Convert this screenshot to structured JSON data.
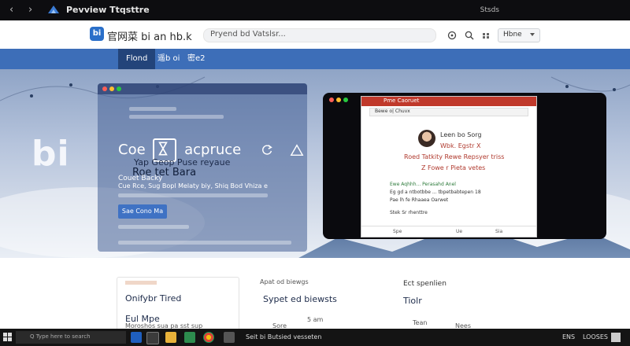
{
  "window": {
    "back": "‹",
    "forward": "›",
    "title": "Pevview Ttqsttre",
    "right_text": "Stsds"
  },
  "header": {
    "brand_badge": "bi",
    "brand_text": "官网菜 bi an hb.k",
    "search_placeholder": "Pryend bd Vatslsr...",
    "locale_label": "Hbne"
  },
  "nav": {
    "items": [
      {
        "label": "Flond",
        "active": true
      },
      {
        "label": "遥b oi",
        "active": false
      },
      {
        "label": "密e2",
        "active": false
      }
    ]
  },
  "hero": {
    "logo": "bi",
    "left_window": {
      "title": "Coe",
      "title_suffix": "acpruce",
      "subtitle1": "Yap Geop Puse reyaue",
      "subtitle2": "Roe tet Bara",
      "label": "Couet Backy",
      "line": "Cue Rce, Sug Bopl Melaty biy, Shiq Bod Vhiza e",
      "button": "Sae Cono Ma"
    },
    "inner_window": {
      "tab": "Pme Caoruet",
      "url": "Bewe o| Chuvx",
      "name": "Leen bo Sorg",
      "line1": "Wbk. Egstr X",
      "line2": "Roed Tatkity Rewe Repsyer triss",
      "line3": "Z Fowe r Pieta vetes",
      "small1": "Ewe Aqhhh... Perasahd Anel",
      "small2": "Eg gd a ntbotbbe ... tbpetbabtepen 18",
      "small3": "Pae lh fe Rhaaea Oarwet",
      "small4": "Stek Sr rhenttre",
      "foot1": "Spe",
      "foot2": "Ue",
      "foot3": "Sia"
    }
  },
  "cards": [
    {
      "title": "Onifybr Tired",
      "sub": "Eul Mpe",
      "sub2": "Moroshos sua pa sst sup"
    },
    {
      "title": "Sypet ed biewsts",
      "sub": "Apat od biewgs",
      "meta": "5 am",
      "meta2": "Sore"
    },
    {
      "title": "Ect spenlien",
      "sub": "Tiolr",
      "meta": "Tean",
      "meta2": "Nees"
    }
  ],
  "taskbar": {
    "search_placeholder": "Q Type here to search",
    "app_label": "Seit bi Butsied vesseten",
    "tray_text": "ENS",
    "time": "LOOSES"
  }
}
